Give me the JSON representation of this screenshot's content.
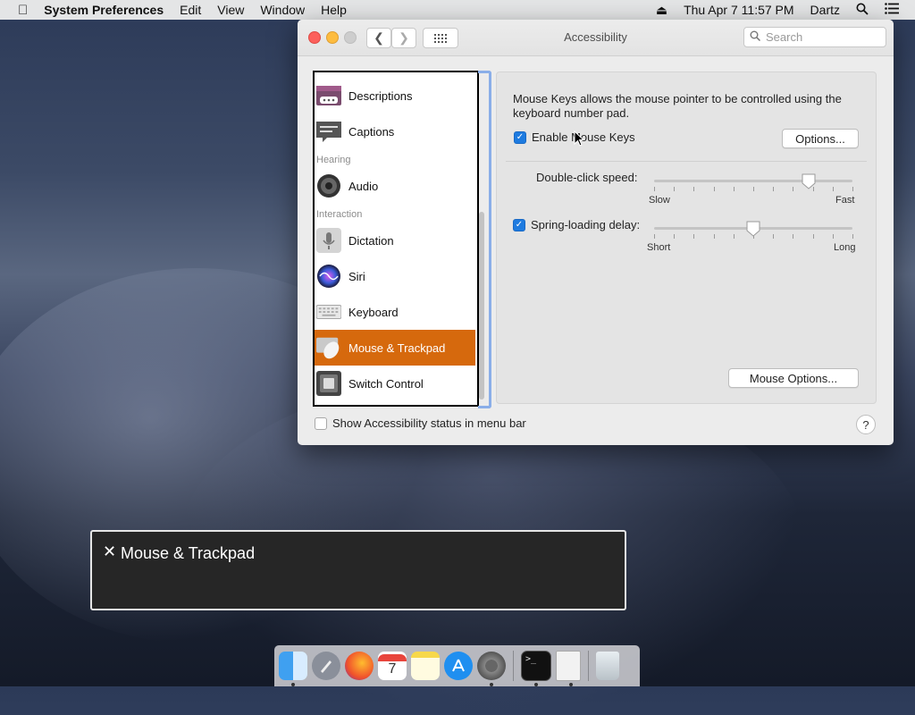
{
  "menubar": {
    "app": "System Preferences",
    "items": [
      "Edit",
      "View",
      "Window",
      "Help"
    ],
    "datetime": "Thu Apr 7  11:57 PM",
    "user": "Dartz"
  },
  "window": {
    "title": "Accessibility",
    "search_placeholder": "Search"
  },
  "sidebar": {
    "items": [
      {
        "label": "Descriptions",
        "icon": "descriptions-icon"
      },
      {
        "label": "Captions",
        "icon": "captions-icon"
      },
      {
        "label": "Audio",
        "icon": "speaker-icon"
      },
      {
        "label": "Dictation",
        "icon": "microphone-icon"
      },
      {
        "label": "Siri",
        "icon": "siri-icon"
      },
      {
        "label": "Keyboard",
        "icon": "keyboard-icon"
      },
      {
        "label": "Mouse & Trackpad",
        "icon": "mouse-icon",
        "selected": true
      },
      {
        "label": "Switch Control",
        "icon": "switch-control-icon"
      }
    ],
    "sections": {
      "hearing": "Hearing",
      "interaction": "Interaction"
    }
  },
  "panel": {
    "description": "Mouse Keys allows the mouse pointer to be controlled using the keyboard number pad.",
    "enable_mouse_keys": {
      "label": "Enable Mouse Keys",
      "checked": true
    },
    "options_button": "Options...",
    "double_click": {
      "label": "Double-click speed:",
      "min_label": "Slow",
      "max_label": "Fast",
      "value": 0.78
    },
    "spring_loading": {
      "label": "Spring-loading delay:",
      "checked": true,
      "min_label": "Short",
      "max_label": "Long",
      "value": 0.5
    },
    "mouse_options_button": "Mouse Options..."
  },
  "footer": {
    "status_label": "Show Accessibility status in menu bar",
    "status_checked": false,
    "help": "?"
  },
  "caption_panel": {
    "close": "✕",
    "text": "Mouse & Trackpad"
  },
  "dock": {
    "apps": [
      "finder-icon",
      "launchpad-icon",
      "firefox-icon",
      "calendar-icon",
      "notes-icon",
      "app-store-icon",
      "system-preferences-icon",
      "terminal-icon",
      "document-icon",
      "trash-icon"
    ],
    "calendar_day": "7"
  },
  "colors": {
    "selection": "#d6690d",
    "checkbox": "#1e7be0"
  }
}
